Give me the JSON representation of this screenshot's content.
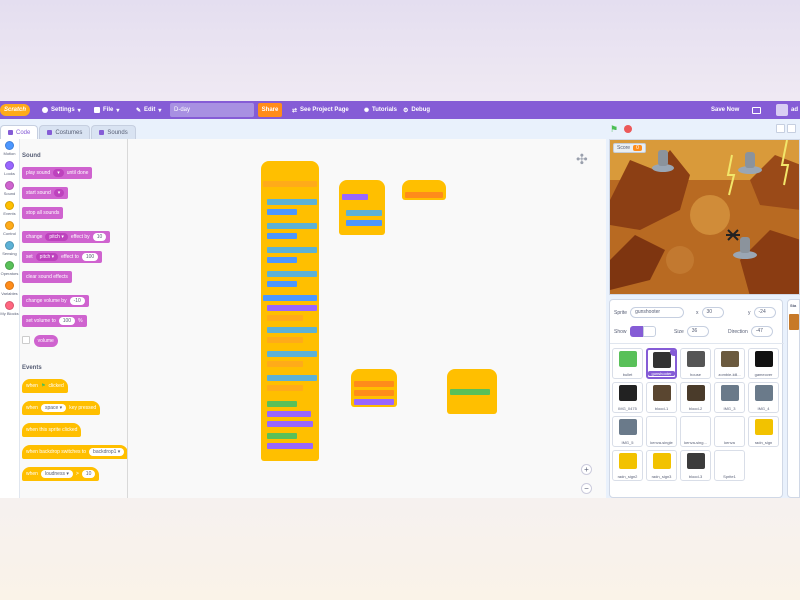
{
  "menubar": {
    "logo": "Scratch",
    "settings": "Settings",
    "file": "File",
    "edit": "Edit",
    "project_title": "D-day",
    "share": "Share",
    "see_project_page": "See Project Page",
    "tutorials": "Tutorials",
    "debug": "Debug",
    "save_now": "Save Now",
    "user_initials": "ad"
  },
  "tabs": [
    {
      "label": "Code"
    },
    {
      "label": "Costumes"
    },
    {
      "label": "Sounds"
    }
  ],
  "categories": [
    {
      "label": "Motion",
      "color": "#4c97ff"
    },
    {
      "label": "Looks",
      "color": "#9966ff"
    },
    {
      "label": "Sound",
      "color": "#cf63cf"
    },
    {
      "label": "Events",
      "color": "#ffbf00"
    },
    {
      "label": "Control",
      "color": "#ffab19"
    },
    {
      "label": "Sensing",
      "color": "#5cb1d6"
    },
    {
      "label": "Operators",
      "color": "#59c059"
    },
    {
      "label": "Variables",
      "color": "#ff8c1a"
    },
    {
      "label": "My Blocks",
      "color": "#ff6680"
    }
  ],
  "palette": {
    "sound_heading": "Sound",
    "play_sound": "play sound",
    "until_done": "until done",
    "start_sound": "start sound",
    "stop_all_sounds": "stop all sounds",
    "change": "change",
    "pitch": "pitch",
    "effect_by": "effect by",
    "effect_by_value": "10",
    "set": "set",
    "effect_to": "effect to",
    "effect_to_value": "100",
    "clear_sound_effects": "clear sound effects",
    "change_volume_by": "change volume by",
    "change_volume_value": "-10",
    "set_volume_to": "set volume to",
    "set_volume_value": "100",
    "percent": "%",
    "volume": "volume",
    "events_heading": "Events",
    "when": "when",
    "clicked": "clicked",
    "space": "space",
    "key_pressed": "key pressed",
    "when_this_sprite_clicked": "when this sprite clicked",
    "when_backdrop_switches_to": "when backdrop switches to",
    "backdrop1": "backdrop1",
    "loudness": "loudness",
    "greater": ">",
    "loudness_value": "10"
  },
  "stage": {
    "score_label": "Score",
    "score_value": "0"
  },
  "sprite_info": {
    "sprite_label": "Sprite",
    "sprite_name": "gunshooter",
    "x_label": "x",
    "x_value": "30",
    "y_label": "y",
    "y_value": "-24",
    "show_label": "Show",
    "size_label": "Size",
    "size_value": "36",
    "direction_label": "Direction",
    "direction_value": "-47"
  },
  "sprites": [
    {
      "name": "bullet",
      "color": "#59c059"
    },
    {
      "name": "gunshooter",
      "color": "#333333"
    },
    {
      "name": "house",
      "color": "#555555"
    },
    {
      "name": "zombie-kill...",
      "color": "#6b5a3e"
    },
    {
      "name": "gameover",
      "color": "#111111"
    },
    {
      "name": "IMG_0475",
      "color": "#222222"
    },
    {
      "name": "blood-1",
      "color": "#5a4630"
    },
    {
      "name": "blood-2",
      "color": "#4a3b2a"
    },
    {
      "name": "IMG_3",
      "color": "#6a7a8a"
    },
    {
      "name": "IMG_4",
      "color": "#6a7a8a"
    },
    {
      "name": "IMG_5",
      "color": "#6a7a8a"
    },
    {
      "name": "kenva-single",
      "color": "#ffffff"
    },
    {
      "name": "kenva-sing...",
      "color": "#ffffff"
    },
    {
      "name": "kenva",
      "color": "#ffffff"
    },
    {
      "name": "radn_sign",
      "color": "#f2c200"
    },
    {
      "name": "radn_sign2",
      "color": "#f2c200"
    },
    {
      "name": "radn_sign3",
      "color": "#f2c200"
    },
    {
      "name": "blood-3",
      "color": "#3b3b3b"
    },
    {
      "name": "Sprite1",
      "color": "#ffffff"
    }
  ],
  "stage_selector": {
    "label": "Sta"
  }
}
